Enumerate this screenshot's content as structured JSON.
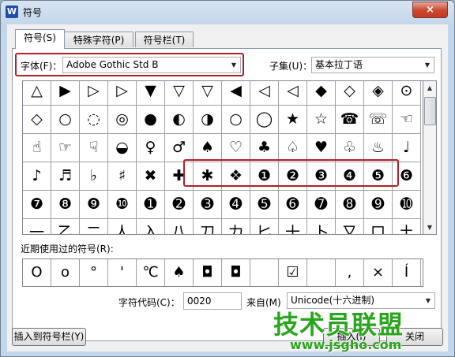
{
  "window": {
    "title": "符号",
    "app_icon": "W",
    "close": "×"
  },
  "tabs": [
    {
      "label": "符号(S)"
    },
    {
      "label": "特殊字符(P)"
    },
    {
      "label": "符号栏(T)"
    }
  ],
  "font": {
    "label": "字体(F)：",
    "value": "Adobe Gothic Std B"
  },
  "subset": {
    "label": "子集(U)：",
    "value": "基本拉丁语"
  },
  "symbols": [
    [
      "△",
      "▶",
      "▷",
      "▷",
      "▼",
      "▽",
      "▽",
      "◀",
      "◁",
      "◁",
      "◆",
      "◇",
      "◈",
      "⊙"
    ],
    [
      "◇",
      "○",
      "◌",
      "◎",
      "●",
      "◐",
      "◑",
      "○",
      "◯",
      "★",
      "☆",
      "☎",
      "☏",
      "☜"
    ],
    [
      "☝",
      "☞",
      "☟",
      "◒",
      "♀",
      "♂",
      "♠",
      "♡",
      "♣",
      "♤",
      "♥",
      "♧",
      "♨",
      "♩"
    ],
    [
      "♪",
      "♬",
      "♭",
      "♯",
      "✖",
      "✚",
      "✱",
      "❖",
      "❶",
      "❷",
      "❸",
      "❹",
      "❺",
      "❻"
    ],
    [
      "❼",
      "❽",
      "❾",
      "❿",
      "➊",
      "➋",
      "➌",
      "➍",
      "➎",
      "➏",
      "➐",
      "➑",
      "➒",
      "➓"
    ],
    [
      "一",
      "乙",
      "二",
      "人",
      "入",
      "八",
      "刀",
      "力",
      "匕",
      "十",
      "卜",
      "又",
      "口",
      "土"
    ]
  ],
  "recent": {
    "label": "近期使用过的符号(R):",
    "items": [
      "O",
      "o",
      "°",
      "'",
      "℃",
      "♠",
      "◘",
      "◘",
      "",
      "☑",
      "",
      ",",
      "×",
      "Í"
    ]
  },
  "char_code": {
    "label": "字符代码(C)：",
    "value": "0020"
  },
  "from": {
    "label": "来自(M)",
    "value": "Unicode(十六进制)"
  },
  "buttons": {
    "insert_to_bar": "插入到符号栏(Y)",
    "insert": "插入(I)",
    "close": "关闭"
  },
  "watermark": {
    "brand": "技术员联盟",
    "url": "www.jsgho.com"
  }
}
